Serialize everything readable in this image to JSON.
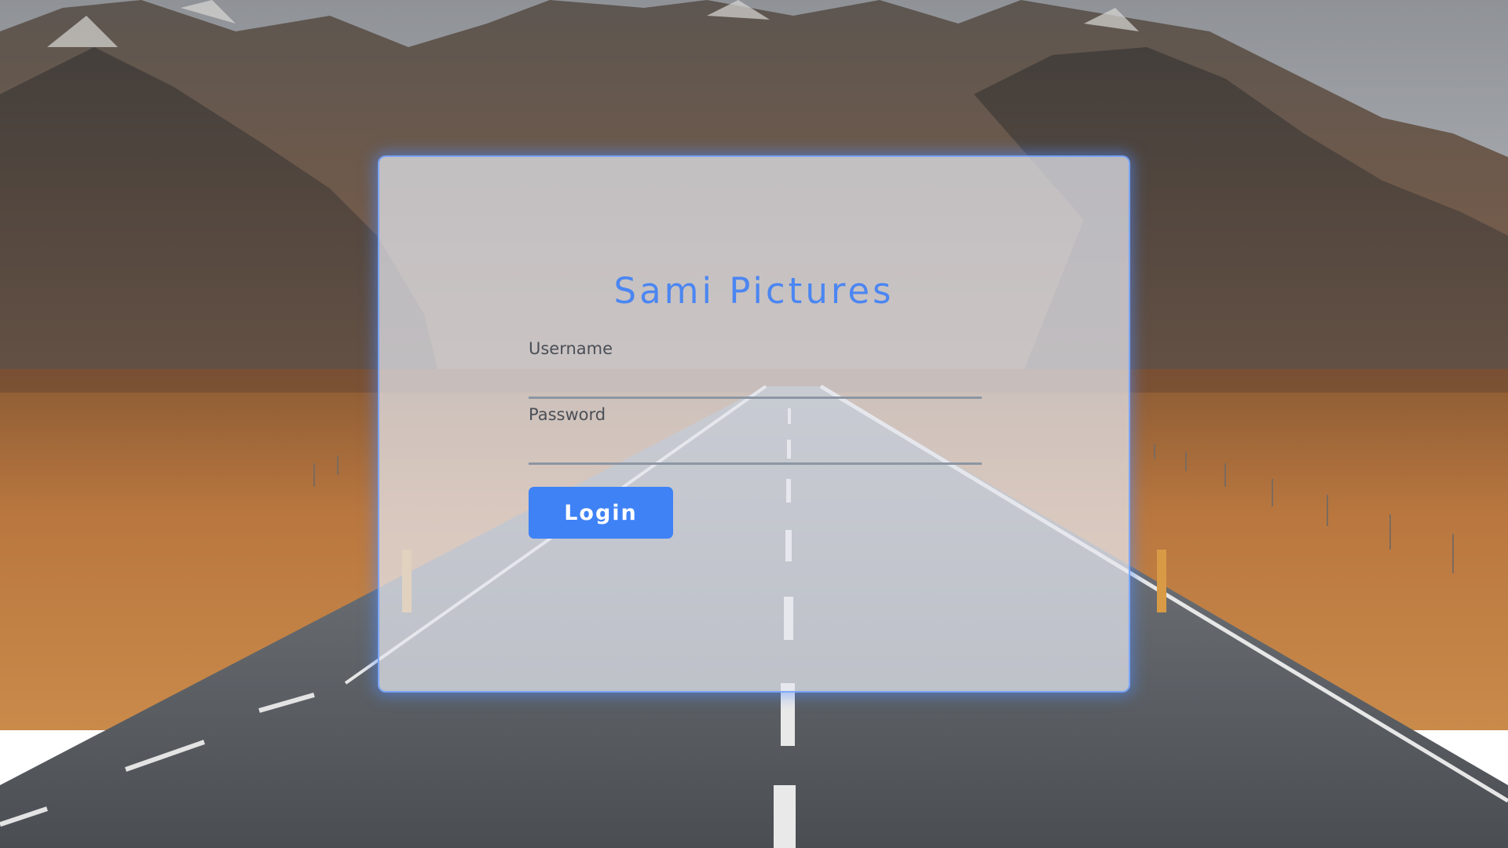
{
  "login": {
    "title": "Sami Pictures",
    "username_label": "Username",
    "username_value": "",
    "password_label": "Password",
    "password_value": "",
    "submit_label": "Login"
  },
  "colors": {
    "accent": "#3f82f6",
    "title": "#4b86f2",
    "card_border": "#6ea0ff"
  }
}
